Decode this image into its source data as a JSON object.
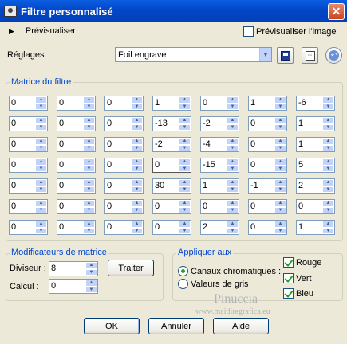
{
  "window": {
    "title": "Filtre personnalisé",
    "close": "✕"
  },
  "preview": {
    "label": "Prévisualiser",
    "image_label": "Prévisualiser l'image",
    "image_checked": false
  },
  "presets": {
    "label": "Réglages",
    "value": "Foil engrave"
  },
  "matrix": {
    "label": "Matrice du filtre",
    "rows": [
      [
        "0",
        "0",
        "0",
        "1",
        "0",
        "1",
        "-6"
      ],
      [
        "0",
        "0",
        "0",
        "-13",
        "-2",
        "0",
        "1"
      ],
      [
        "0",
        "0",
        "0",
        "-2",
        "-4",
        "0",
        "1"
      ],
      [
        "0",
        "0",
        "0",
        "0",
        "-15",
        "0",
        "5"
      ],
      [
        "0",
        "0",
        "0",
        "30",
        "1",
        "-1",
        "2"
      ],
      [
        "0",
        "0",
        "0",
        "0",
        "0",
        "0",
        "0"
      ],
      [
        "0",
        "0",
        "0",
        "0",
        "2",
        "0",
        "1"
      ]
    ]
  },
  "modifiers": {
    "label": "Modificateurs de matrice",
    "divisor_label": "Diviseur :",
    "divisor": "8",
    "bias_label": "Calcul :",
    "bias": "0",
    "process_label": "Traiter"
  },
  "apply": {
    "label": "Appliquer aux",
    "channels_label": "Canaux chromatiques :",
    "gray_label": "Valeurs de gris",
    "red": "Rouge",
    "green": "Vert",
    "blue": "Bleu"
  },
  "watermark": {
    "name": "Pinuccia",
    "url": "www.maidiregrafica.eu"
  },
  "buttons": {
    "ok": "OK",
    "cancel": "Annuler",
    "help": "Aide"
  }
}
